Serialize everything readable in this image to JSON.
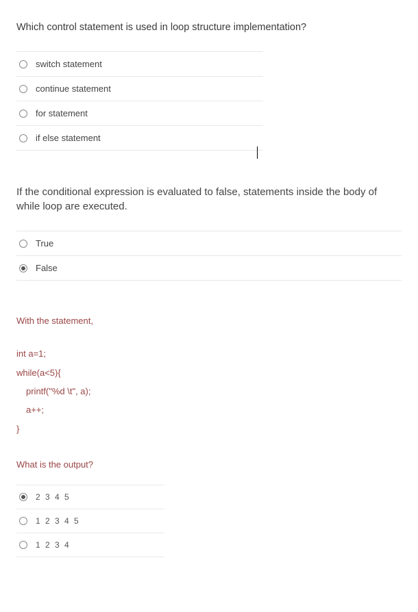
{
  "q1": {
    "text": "Which control statement is used in loop structure implementation?",
    "options": [
      {
        "label": "switch statement",
        "selected": false
      },
      {
        "label": "continue statement",
        "selected": false
      },
      {
        "label": "for statement",
        "selected": false
      },
      {
        "label": "if else statement",
        "selected": false
      }
    ]
  },
  "q2": {
    "text": "If the conditional expression is evaluated to false, statements inside the body of while loop are executed.",
    "options": [
      {
        "label": "True",
        "selected": false
      },
      {
        "label": "False",
        "selected": true
      }
    ]
  },
  "q3": {
    "intro": "With the statement,",
    "code": {
      "l1": "int a=1;",
      "l2": "while(a<5){",
      "l3": "printf(\"%d \\t\", a);",
      "l4": "a++;",
      "l5": "}"
    },
    "outputQuestion": "What is the output?",
    "options": [
      {
        "label": "2 3 4 5",
        "selected": true
      },
      {
        "label": "1 2 3 4 5",
        "selected": false
      },
      {
        "label": "1 2 3 4",
        "selected": false
      }
    ]
  }
}
